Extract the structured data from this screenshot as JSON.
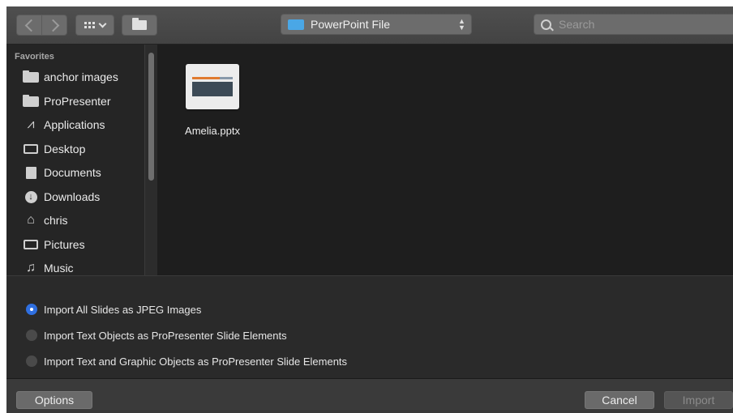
{
  "toolbar": {
    "back_icon": "chevron-left-icon",
    "forward_icon": "chevron-right-icon",
    "view_icon": "icon-grid-view-icon",
    "new_folder_icon": "new-folder-icon",
    "location": "PowerPoint File",
    "search_placeholder": "Search"
  },
  "sidebar": {
    "section": "Favorites",
    "items": [
      {
        "label": "anchor images",
        "icon": "folder-icon"
      },
      {
        "label": "ProPresenter",
        "icon": "folder-icon"
      },
      {
        "label": "Applications",
        "icon": "applications-icon"
      },
      {
        "label": "Desktop",
        "icon": "desktop-icon"
      },
      {
        "label": "Documents",
        "icon": "documents-icon"
      },
      {
        "label": "Downloads",
        "icon": "downloads-icon"
      },
      {
        "label": "chris",
        "icon": "home-icon"
      },
      {
        "label": "Pictures",
        "icon": "camera-icon"
      },
      {
        "label": "Music",
        "icon": "music-note-icon"
      }
    ]
  },
  "files": [
    {
      "name": "Amelia.pptx",
      "icon": "pptx-thumbnail"
    }
  ],
  "import_options": [
    {
      "label": "Import All Slides as JPEG Images",
      "selected": true
    },
    {
      "label": "Import Text Objects as ProPresenter Slide Elements",
      "selected": false
    },
    {
      "label": "Import Text and Graphic Objects as ProPresenter Slide Elements",
      "selected": false
    }
  ],
  "buttons": {
    "options": "Options",
    "cancel": "Cancel",
    "import": "Import"
  },
  "colors": {
    "accent": "#2f6fe0",
    "location_folder": "#4aa7e6"
  }
}
